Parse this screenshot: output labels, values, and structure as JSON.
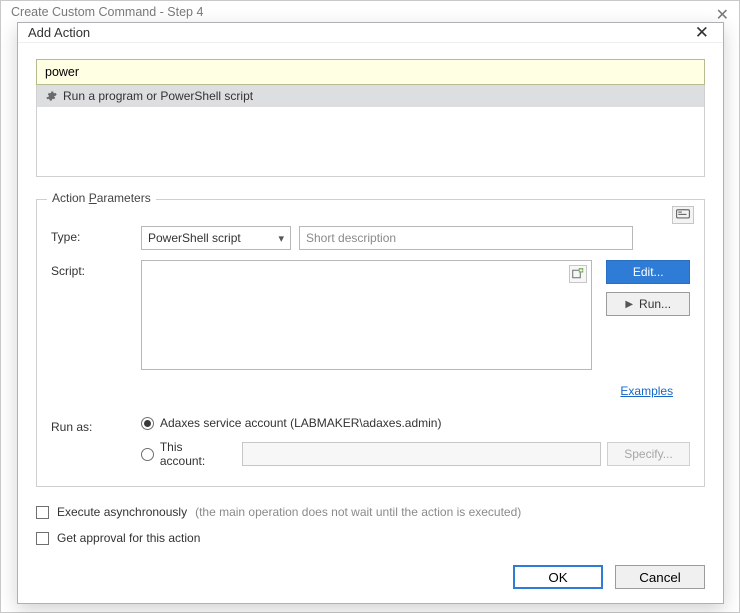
{
  "background": {
    "title": "Create Custom Command - Step 4"
  },
  "dialog": {
    "title": "Add Action",
    "search_value": "power",
    "result_label": "Run a program or PowerShell script",
    "group_title_prefix": "Action ",
    "group_title_underline": "P",
    "group_title_suffix": "arameters",
    "type_label": "Type:",
    "type_value": "PowerShell script",
    "desc_placeholder": "Short description",
    "script_label": "Script:",
    "edit_btn": "Edit...",
    "run_btn": "Run...",
    "examples_link": "Examples",
    "runas_label": "Run as:",
    "radio_adaxes": "Adaxes service account (LABMAKER\\adaxes.admin)",
    "radio_thisaccount": "This account:",
    "specify_btn": "Specify...",
    "exec_async": "Execute asynchronously",
    "exec_async_hint": "(the main operation does not wait until the action is executed)",
    "get_approval": "Get approval for this action",
    "ok": "OK",
    "cancel": "Cancel"
  }
}
